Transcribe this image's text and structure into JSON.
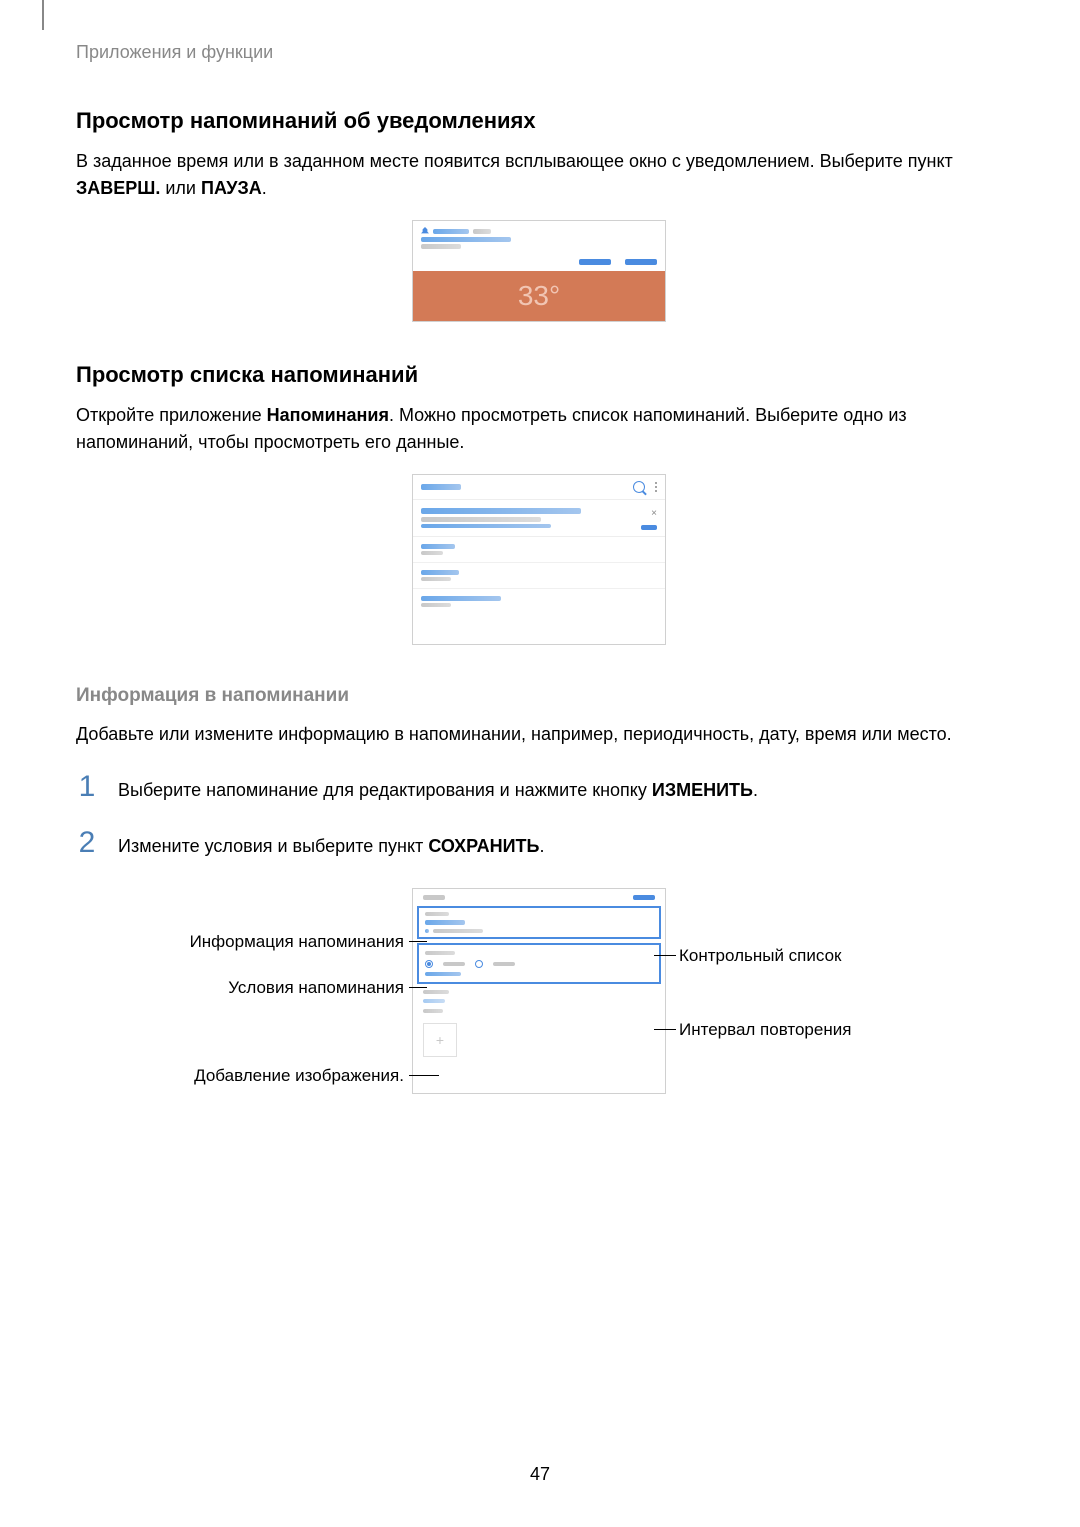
{
  "header": "Приложения и функции",
  "section1": {
    "title": "Просмотр напоминаний об уведомлениях",
    "para_a": "В заданное время или в заданном месте появится всплывающее окно с уведомлением. Выберите пункт ",
    "b1": "ЗАВЕРШ.",
    "mid": " или ",
    "b2": "ПАУЗА",
    "end": "."
  },
  "notif": {
    "temp": "33°"
  },
  "section2": {
    "title": "Просмотр списка напоминаний",
    "para_a": "Откройте приложение ",
    "b1": "Напоминания",
    "para_b": ". Можно просмотреть список напоминаний. Выберите одно из напоминаний, чтобы просмотреть его данные."
  },
  "section3": {
    "title": "Информация в напоминании",
    "para": "Добавьте или измените информацию в напоминании, например, периодичность, дату, время или место."
  },
  "steps": {
    "n1": "1",
    "t1_a": "Выберите напоминание для редактирования и нажмите кнопку ",
    "t1_b": "ИЗМЕНИТЬ",
    "t1_c": ".",
    "n2": "2",
    "t2_a": "Измените условия и выберите пункт ",
    "t2_b": "СОХРАНИТЬ",
    "t2_c": "."
  },
  "callouts": {
    "l1": "Информация напоминания",
    "l2": "Условия напоминания",
    "l3": "Добавление изображения.",
    "r1": "Контрольный список",
    "r2": "Интервал повторения"
  },
  "page_num": "47"
}
